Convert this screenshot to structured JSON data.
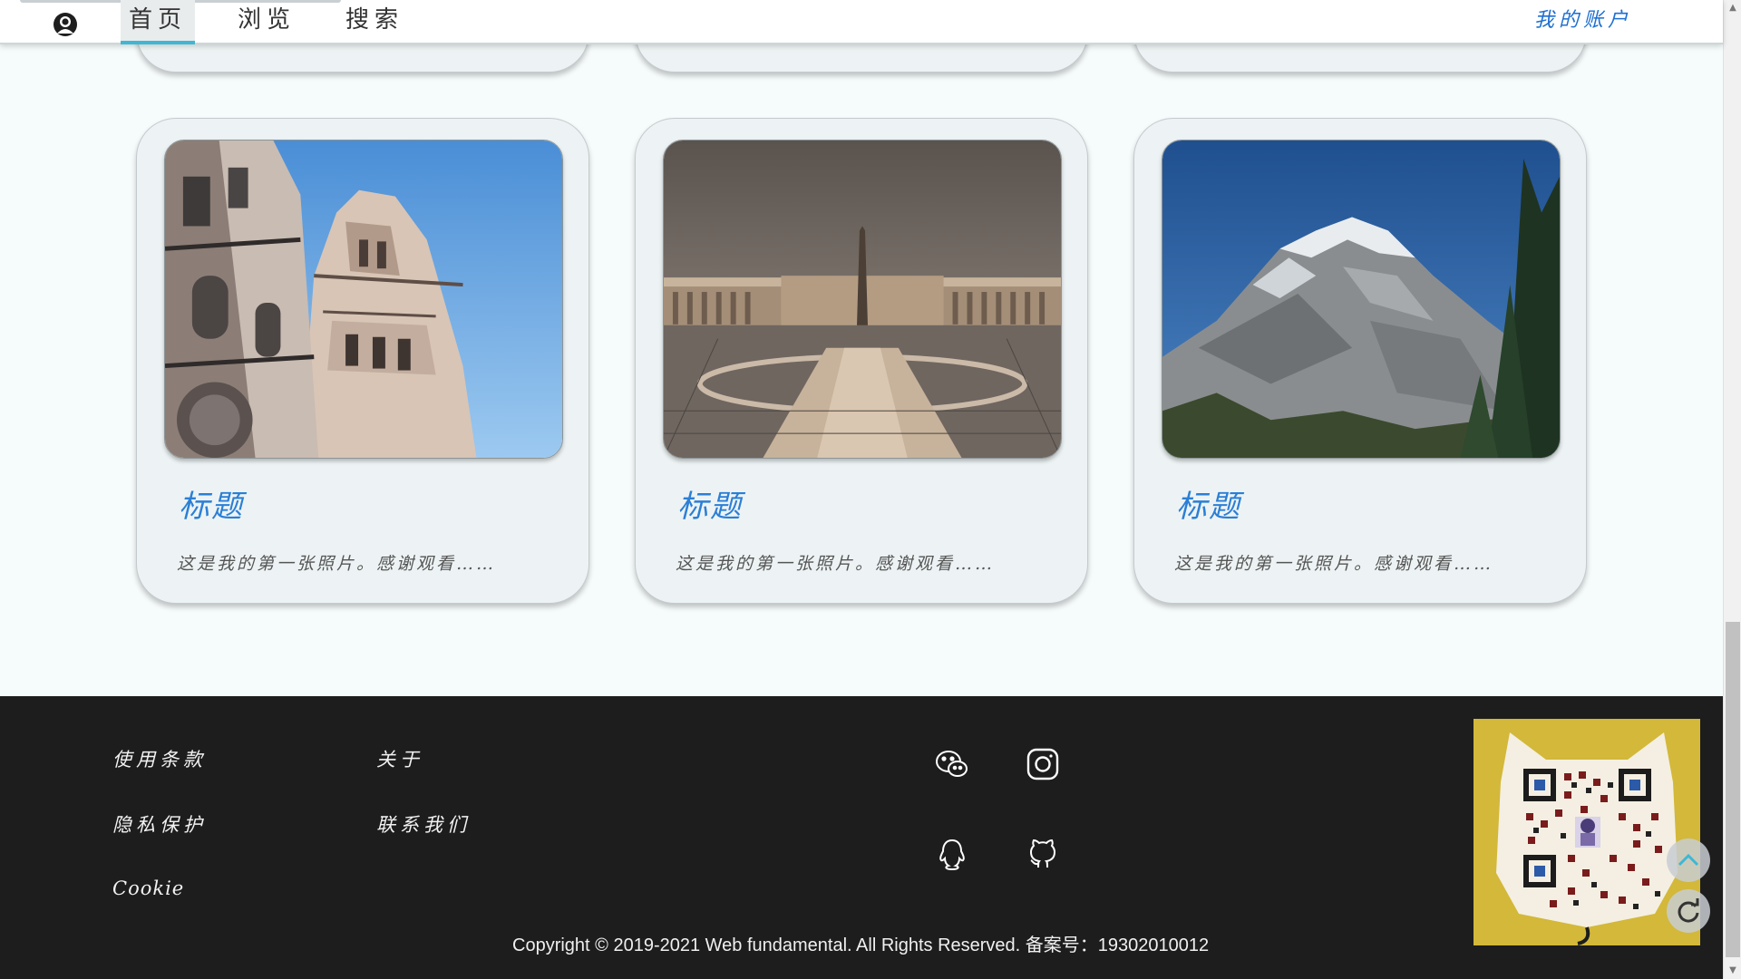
{
  "nav": {
    "tabs": [
      {
        "label": "首页"
      },
      {
        "label": "浏览"
      },
      {
        "label": "搜索"
      }
    ],
    "account_label": "我的账户",
    "avatar_icon": "user-avatar-icon"
  },
  "cards": [
    {
      "title": "标题",
      "description": "这是我的第一张照片。感谢观看……",
      "image": "cathedral-bell-tower"
    },
    {
      "title": "标题",
      "description": "这是我的第一张照片。感谢观看……",
      "image": "plaza-with-obelisk"
    },
    {
      "title": "标题",
      "description": "这是我的第一张照片。感谢观看……",
      "image": "snowy-mountain"
    }
  ],
  "footer": {
    "links_col1": [
      "使用条款",
      "隐私保护",
      "Cookie"
    ],
    "links_col2": [
      "关于",
      "联系我们"
    ],
    "social_icons": [
      "wechat-icon",
      "instagram-icon",
      "qq-icon",
      "github-icon"
    ],
    "copyright": "Copyright © 2019-2021 Web fundamental. All Rights Reserved. 备案号：19302010012",
    "qr_image": "qr-code-cat"
  },
  "floating_buttons": [
    "scroll-to-top-icon",
    "refresh-icon"
  ],
  "colors": {
    "accent": "#3fb7d3",
    "link_blue": "#2b7fd6",
    "footer_bg": "#1d1d1d",
    "page_bg": "#f6fbfb"
  }
}
